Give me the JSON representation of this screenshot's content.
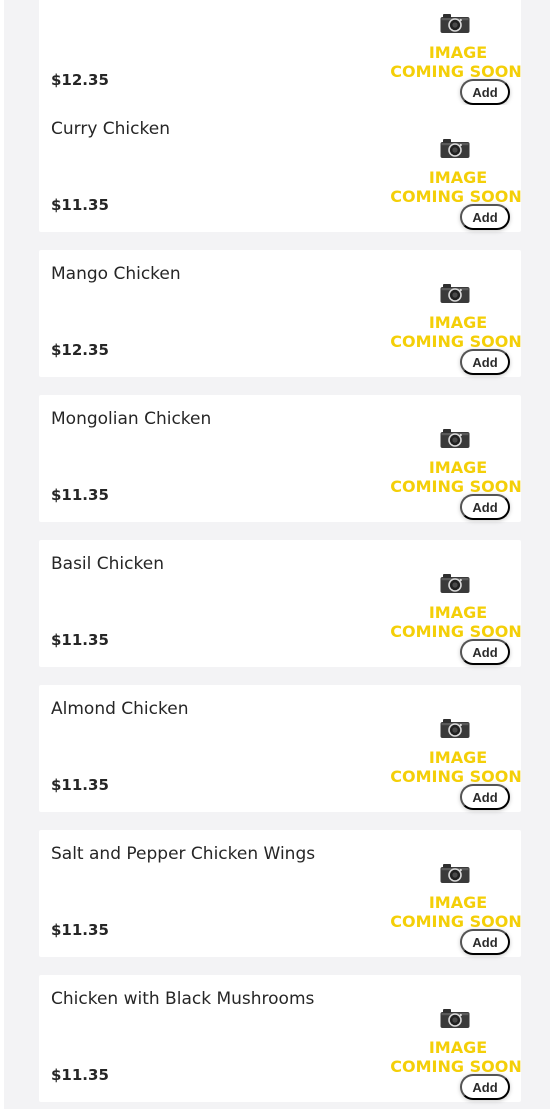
{
  "menu_items": [
    {
      "name": "",
      "price": "$12.35",
      "add_label": "Add",
      "image_text_1": "IMAGE",
      "image_text_2": "COMING SOON",
      "image_icon": "camera-icon"
    },
    {
      "name": "Curry Chicken",
      "price": "$11.35",
      "add_label": "Add",
      "image_text_1": "IMAGE",
      "image_text_2": "COMING SOON",
      "image_icon": "camera-icon"
    },
    {
      "name": "Mango Chicken",
      "price": "$12.35",
      "add_label": "Add",
      "image_text_1": "IMAGE",
      "image_text_2": "COMING SOON",
      "image_icon": "camera-icon"
    },
    {
      "name": "Mongolian Chicken",
      "price": "$11.35",
      "add_label": "Add",
      "image_text_1": "IMAGE",
      "image_text_2": "COMING SOON",
      "image_icon": "camera-icon"
    },
    {
      "name": "Basil Chicken",
      "price": "$11.35",
      "add_label": "Add",
      "image_text_1": "IMAGE",
      "image_text_2": "COMING SOON",
      "image_icon": "camera-icon"
    },
    {
      "name": "Almond Chicken",
      "price": "$11.35",
      "add_label": "Add",
      "image_text_1": "IMAGE",
      "image_text_2": "COMING SOON",
      "image_icon": "camera-icon"
    },
    {
      "name": "Salt and Pepper Chicken Wings",
      "price": "$11.35",
      "add_label": "Add",
      "image_text_1": "IMAGE",
      "image_text_2": "COMING SOON",
      "image_icon": "camera-icon"
    },
    {
      "name": "Chicken with Black Mushrooms",
      "price": "$11.35",
      "add_label": "Add",
      "image_text_1": "IMAGE",
      "image_text_2": "COMING SOON",
      "image_icon": "camera-icon"
    }
  ],
  "colors": {
    "panel_bg": "#f3f3f5",
    "card_bg": "#ffffff",
    "image_text": "#f4cf08"
  }
}
